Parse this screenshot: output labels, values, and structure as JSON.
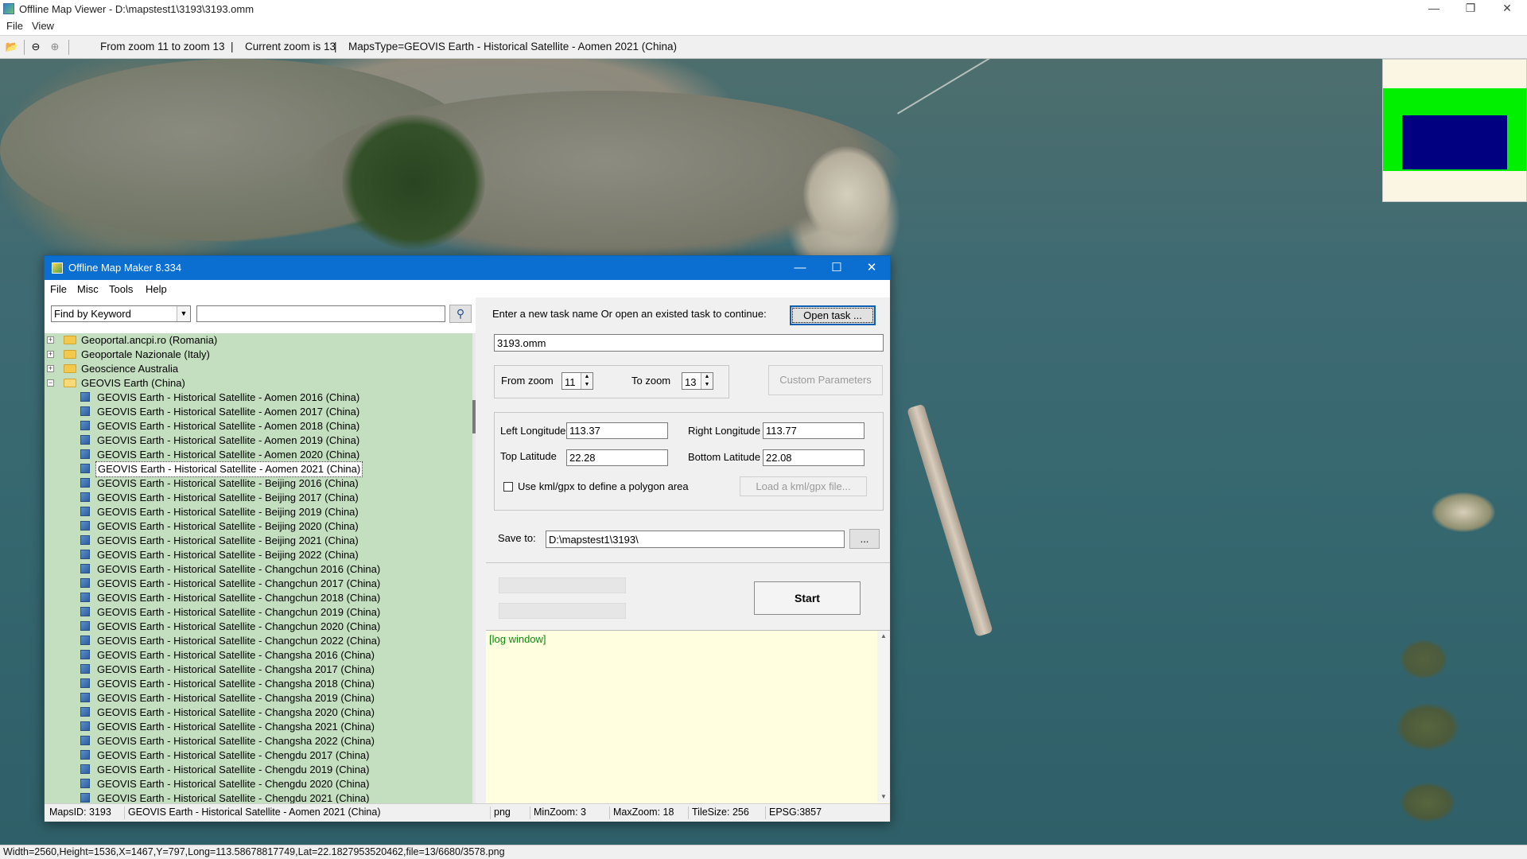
{
  "viewer": {
    "title": "Offline Map Viewer - D:\\mapstest1\\3193\\3193.omm",
    "menu": [
      "File",
      "View"
    ],
    "toolbar": {
      "zoom_range": "From zoom 11 to zoom 13",
      "separator1": "|",
      "current_zoom": "Current zoom is 13",
      "separator2": "|",
      "maps_type": "MapsType=GEOVIS Earth - Historical Satellite - Aomen 2021 (China)"
    },
    "status": "Width=2560,Height=1536,X=1467,Y=797,Long=113.58678817749,Lat=22.1827953520462,file=13/6680/3578.png",
    "window_controls": {
      "minimize": "—",
      "maximize": "❐",
      "close": "✕"
    }
  },
  "colors": {
    "tree_bg": "#c4dfbf",
    "log_bg": "#ffffe0",
    "log_text": "#0c8a0c",
    "dialog_title_bg": "#0a6fd0",
    "minimap_zone": "#00f000",
    "minimap_view": "#000080"
  },
  "dialog": {
    "title": "Offline Map Maker 8.334",
    "menu": [
      "File",
      "Misc",
      "Tools",
      "Help"
    ],
    "search": {
      "type": "Find by Keyword",
      "value": "",
      "button_icon": "search-icon"
    },
    "tree": {
      "folders": [
        {
          "label": "Geoportal.ancpi.ro (Romania)",
          "expanded": false
        },
        {
          "label": "Geoportale Nazionale (Italy)",
          "expanded": false
        },
        {
          "label": "Geoscience Australia",
          "expanded": false
        },
        {
          "label": "GEOVIS Earth (China)",
          "expanded": true
        }
      ],
      "items": [
        "GEOVIS Earth - Historical Satellite - Aomen 2016 (China)",
        "GEOVIS Earth - Historical Satellite - Aomen 2017 (China)",
        "GEOVIS Earth - Historical Satellite - Aomen 2018 (China)",
        "GEOVIS Earth - Historical Satellite - Aomen 2019 (China)",
        "GEOVIS Earth - Historical Satellite - Aomen 2020 (China)",
        "GEOVIS Earth - Historical Satellite - Aomen 2021 (China)",
        "GEOVIS Earth - Historical Satellite - Beijing 2016 (China)",
        "GEOVIS Earth - Historical Satellite - Beijing 2017 (China)",
        "GEOVIS Earth - Historical Satellite - Beijing 2019 (China)",
        "GEOVIS Earth - Historical Satellite - Beijing 2020 (China)",
        "GEOVIS Earth - Historical Satellite - Beijing 2021 (China)",
        "GEOVIS Earth - Historical Satellite - Beijing 2022 (China)",
        "GEOVIS Earth - Historical Satellite - Changchun 2016 (China)",
        "GEOVIS Earth - Historical Satellite - Changchun 2017 (China)",
        "GEOVIS Earth - Historical Satellite - Changchun 2018 (China)",
        "GEOVIS Earth - Historical Satellite - Changchun 2019 (China)",
        "GEOVIS Earth - Historical Satellite - Changchun 2020 (China)",
        "GEOVIS Earth - Historical Satellite - Changchun 2022 (China)",
        "GEOVIS Earth - Historical Satellite - Changsha 2016 (China)",
        "GEOVIS Earth - Historical Satellite - Changsha 2017 (China)",
        "GEOVIS Earth - Historical Satellite - Changsha 2018 (China)",
        "GEOVIS Earth - Historical Satellite - Changsha 2019 (China)",
        "GEOVIS Earth - Historical Satellite - Changsha 2020 (China)",
        "GEOVIS Earth - Historical Satellite - Changsha 2021 (China)",
        "GEOVIS Earth - Historical Satellite - Changsha 2022 (China)",
        "GEOVIS Earth - Historical Satellite - Chengdu 2017 (China)",
        "GEOVIS Earth - Historical Satellite - Chengdu 2019 (China)",
        "GEOVIS Earth - Historical Satellite - Chengdu 2020 (China)",
        "GEOVIS Earth - Historical Satellite - Chengdu 2021 (China)"
      ],
      "selected_index": 5
    },
    "task": {
      "prompt": "Enter a new task name Or open an existed task to continue:",
      "open_button": "Open task ...",
      "name": "3193.omm"
    },
    "zoom": {
      "from_label": "From zoom",
      "from_value": "11",
      "to_label": "To zoom",
      "to_value": "13",
      "custom_button": "Custom Parameters"
    },
    "bounds": {
      "left_lon_label": "Left Longitude",
      "left_lon": "113.37",
      "right_lon_label": "Right Longitude",
      "right_lon": "113.77",
      "top_lat_label": "Top Latitude",
      "top_lat": "22.28",
      "bottom_lat_label": "Bottom Latitude",
      "bottom_lat": "22.08",
      "kml_label": "Use kml/gpx to define a polygon area",
      "kml_checked": false,
      "kml_button": "Load a kml/gpx file..."
    },
    "save": {
      "label": "Save to:",
      "path": "D:\\mapstest1\\3193\\",
      "browse": "..."
    },
    "progress": {
      "bar1": 0,
      "bar2": 0
    },
    "start_button": "Start",
    "log": "[log window]",
    "status": {
      "maps_id": "MapsID: 3193",
      "map_name": "GEOVIS Earth - Historical Satellite - Aomen 2021 (China)",
      "format": "png",
      "min_zoom": "MinZoom: 3",
      "max_zoom": "MaxZoom: 18",
      "tile_size": "TileSize: 256",
      "epsg": "EPSG:3857"
    }
  }
}
